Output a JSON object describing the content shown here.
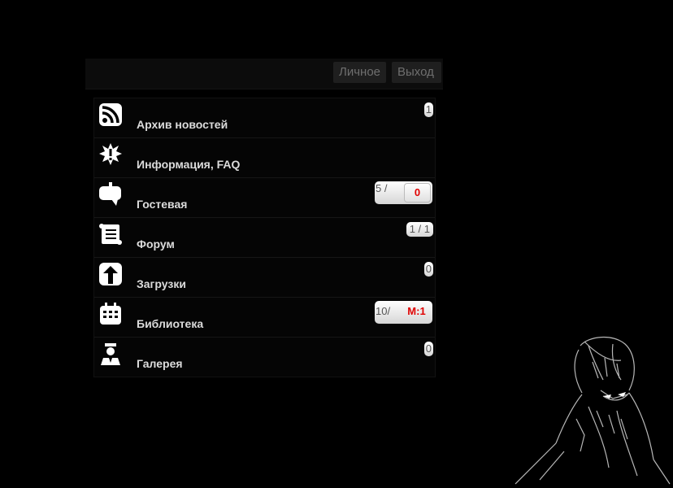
{
  "header": {
    "personal_label": "Личное",
    "exit_label": "Выход"
  },
  "menu": {
    "items": [
      {
        "label": "Архив новостей",
        "icon": "rss-icon",
        "badge": "1"
      },
      {
        "label": "Информация, FAQ",
        "icon": "alert-burst-icon"
      },
      {
        "label": "Гостевая",
        "icon": "speech-bubble-icon",
        "badge_prefix": "5 /",
        "badge_highlight": "0"
      },
      {
        "label": "Форум",
        "icon": "scroll-icon",
        "badge": "1 / 1"
      },
      {
        "label": "Загрузки",
        "icon": "upload-arrow-icon",
        "badge": "0"
      },
      {
        "label": "Библиотека",
        "icon": "calendar-book-icon",
        "badge_prefix": "10/",
        "badge_highlight": "M:1"
      },
      {
        "label": "Галерея",
        "icon": "person-icon",
        "badge": "0"
      }
    ]
  },
  "colors": {
    "background": "#000000",
    "highlight": "#e00000",
    "label": "#dcdcdc"
  },
  "decor": {
    "figure": "hooded-figure-sketch"
  }
}
